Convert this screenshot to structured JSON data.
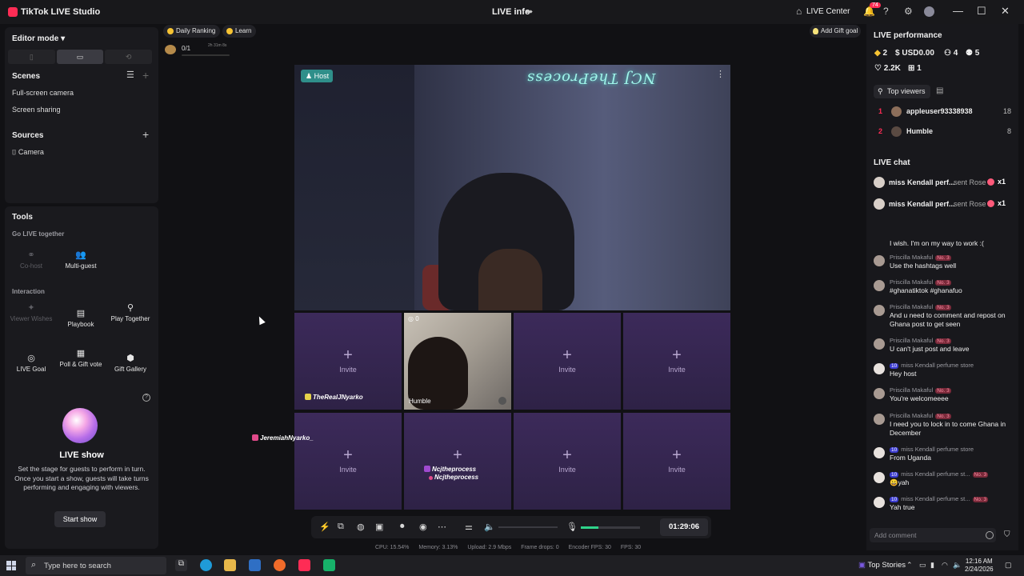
{
  "app": {
    "title": "TikTok LIVE Studio",
    "center_title": "LIVE info",
    "live_center": "LIVE Center",
    "notification_count": "74"
  },
  "left": {
    "editor_mode": "Editor mode",
    "scenes_title": "Scenes",
    "scenes": [
      "Full-screen camera",
      "Screen sharing"
    ],
    "sources_title": "Sources",
    "sources": [
      "Camera"
    ],
    "tools_title": "Tools",
    "go_live_together": "Go LIVE together",
    "cohost": "Co-host",
    "multi_guest": "Multi-guest",
    "interaction": "Interaction",
    "viewer_wishes": "Viewer Wishes",
    "playbook": "Playbook",
    "play_together": "Play Together",
    "live_goal": "LIVE Goal",
    "poll_gift_vote": "Poll & Gift vote",
    "gift_gallery": "Gift Gallery",
    "live_show_title": "LIVE show",
    "live_show_desc": "Set the stage for guests to perform in turn. Once you start a show, guests will take turns performing and engaging with viewers.",
    "start_show": "Start show"
  },
  "top_bar": {
    "daily_ranking": "Daily Ranking",
    "learn": "Learn",
    "goal_progress": "0/1",
    "goal_time": "2h 31m 8s",
    "add_gift_goal": "Add Gift goal"
  },
  "stage": {
    "host_badge": "Host",
    "invite_label": "Invite",
    "guest_name": "Humble",
    "guest_count": "0",
    "tag_1": "TheRealJNyarko",
    "tag_2": "JeremiahNyarko_",
    "tag_3a": "Ncjtheprocess",
    "tag_3b": "Ncjtheprocess",
    "neon_sign": "NCJ TheProcess"
  },
  "controls": {
    "timer": "01:29:06",
    "mic_level": 0.3,
    "stats": {
      "cpu": "CPU: 15.54%",
      "memory": "Memory: 3.13%",
      "upload": "Upload: 2.9 Mbps",
      "frame_drops": "Frame drops: 0",
      "encoder_fps": "Encoder FPS: 30",
      "fps": "FPS: 30"
    }
  },
  "right": {
    "performance_title": "LIVE performance",
    "diamonds": "2",
    "usd": "USD0.00",
    "viewers": "4",
    "new_followers": "5",
    "likes": "2.2K",
    "gifters": "1",
    "top_viewers_label": "Top viewers",
    "top_viewers": [
      {
        "rank": "1",
        "name": "appleuser93338938",
        "score": "18"
      },
      {
        "rank": "2",
        "name": "Humble",
        "score": "8"
      }
    ],
    "chat_title": "LIVE chat",
    "gift_msgs": [
      {
        "name": "miss Kendall perf...",
        "sent": "sent Rose",
        "count": "x1"
      },
      {
        "name": "miss Kendall perf...",
        "sent": "sent Rose",
        "count": "x1"
      }
    ],
    "messages": [
      {
        "name": "",
        "lvl": "",
        "no": "",
        "text": "I wish. I'm on my way to work :("
      },
      {
        "name": "Priscilla Makaful",
        "lvl": "",
        "no": "No. 3",
        "text": "Use the hashtags well"
      },
      {
        "name": "Priscilla Makaful",
        "lvl": "",
        "no": "No. 3",
        "text": "#ghanatiktok #ghanafuo"
      },
      {
        "name": "Priscilla Makaful",
        "lvl": "",
        "no": "No. 3",
        "text": "And u need to comment and repost on Ghana post to get seen"
      },
      {
        "name": "Priscilla Makaful",
        "lvl": "",
        "no": "No. 3",
        "text": "U can't just post and leave"
      },
      {
        "name": "miss Kendall perfume store",
        "lvl": "10",
        "no": "",
        "text": "Hey host"
      },
      {
        "name": "Priscilla Makaful",
        "lvl": "",
        "no": "No. 3",
        "text": "You're welcomeeee"
      },
      {
        "name": "Priscilla Makaful",
        "lvl": "",
        "no": "No. 3",
        "text": "I need you to lock in to come Ghana in December"
      },
      {
        "name": "miss Kendall perfume store",
        "lvl": "10",
        "no": "",
        "text": "From Uganda"
      },
      {
        "name": "miss Kendall perfume st...",
        "lvl": "10",
        "no": "No. 3",
        "text": "😀yah"
      },
      {
        "name": "miss Kendall perfume st...",
        "lvl": "10",
        "no": "No. 3",
        "text": "Yah true"
      }
    ],
    "comment_placeholder": "Add comment"
  },
  "taskbar": {
    "search_placeholder": "Type here to search",
    "top_stories": "Top Stories",
    "time": "12:16 AM",
    "date": "2/24/2026"
  }
}
